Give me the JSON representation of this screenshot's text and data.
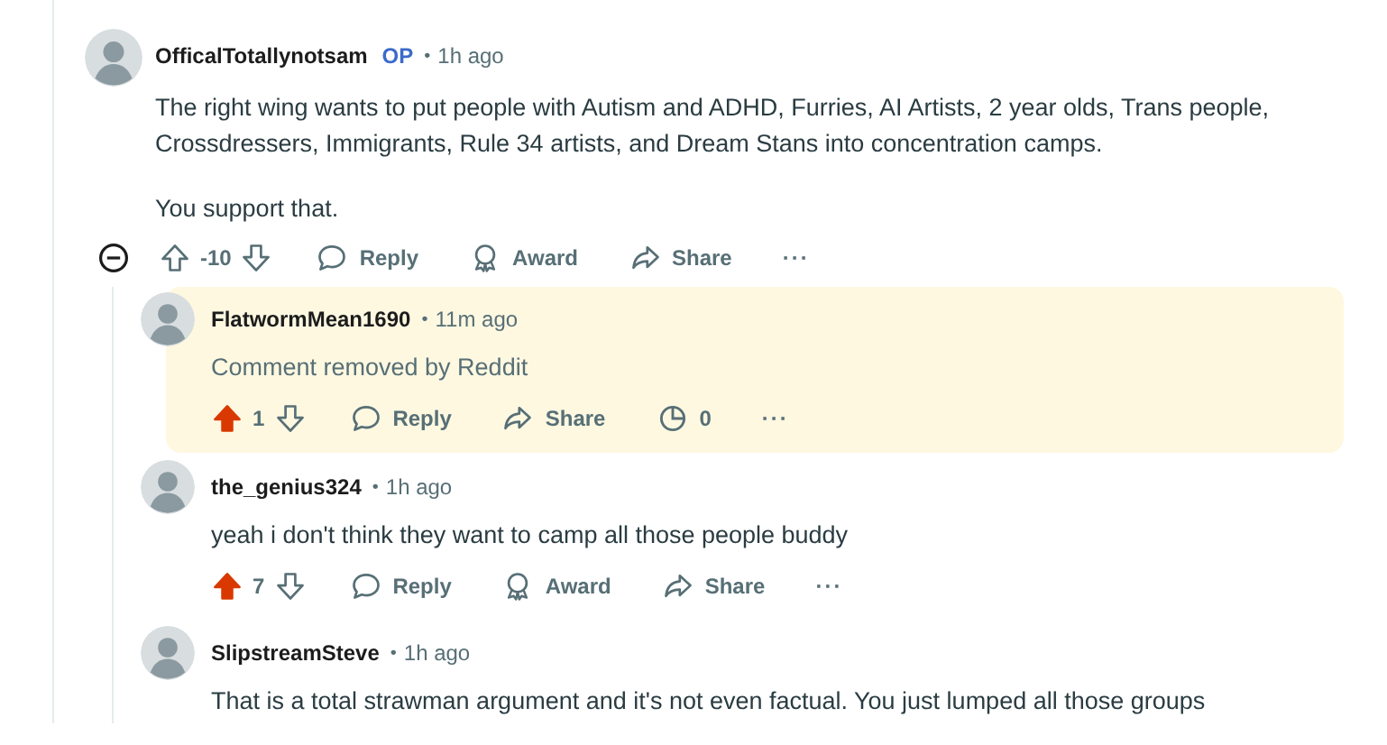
{
  "comment": {
    "author": "OfficalTotallynotsam",
    "badge": "OP",
    "separator": "•",
    "time": "1h ago",
    "body": [
      "The right wing wants to put people with Autism and ADHD, Furries, AI Artists, 2 year olds, Trans people, Crossdressers, Immigrants, Rule 34 artists, and Dream Stans into concentration camps.",
      "You support that."
    ],
    "removed": false,
    "score": "-10",
    "upvoted": false,
    "expanded": true,
    "actions": [
      {
        "kind": "reply",
        "label": "Reply"
      },
      {
        "kind": "award",
        "label": "Award"
      },
      {
        "kind": "share",
        "label": "Share"
      },
      {
        "kind": "more",
        "label": "···"
      }
    ],
    "replies": [
      {
        "author": "FlatwormMean1690",
        "separator": "•",
        "time": "11m ago",
        "highlighted": true,
        "removed": true,
        "body": [
          "Comment removed by Reddit"
        ],
        "score": "1",
        "upvoted": true,
        "actions": [
          {
            "kind": "reply",
            "label": "Reply"
          },
          {
            "kind": "share",
            "label": "Share"
          },
          {
            "kind": "timer",
            "label": "0"
          },
          {
            "kind": "more",
            "label": "···"
          }
        ]
      },
      {
        "author": "the_genius324",
        "separator": "•",
        "time": "1h ago",
        "highlighted": false,
        "removed": false,
        "body": [
          "yeah i don't think they want to camp all those people buddy"
        ],
        "score": "7",
        "upvoted": true,
        "actions": [
          {
            "kind": "reply",
            "label": "Reply"
          },
          {
            "kind": "award",
            "label": "Award"
          },
          {
            "kind": "share",
            "label": "Share"
          },
          {
            "kind": "more",
            "label": "···"
          }
        ]
      },
      {
        "author": "SlipstreamSteve",
        "separator": "•",
        "time": "1h ago",
        "highlighted": false,
        "removed": false,
        "body": [
          "That is a total strawman argument and it's not even factual. You just lumped all those groups"
        ]
      }
    ]
  }
}
